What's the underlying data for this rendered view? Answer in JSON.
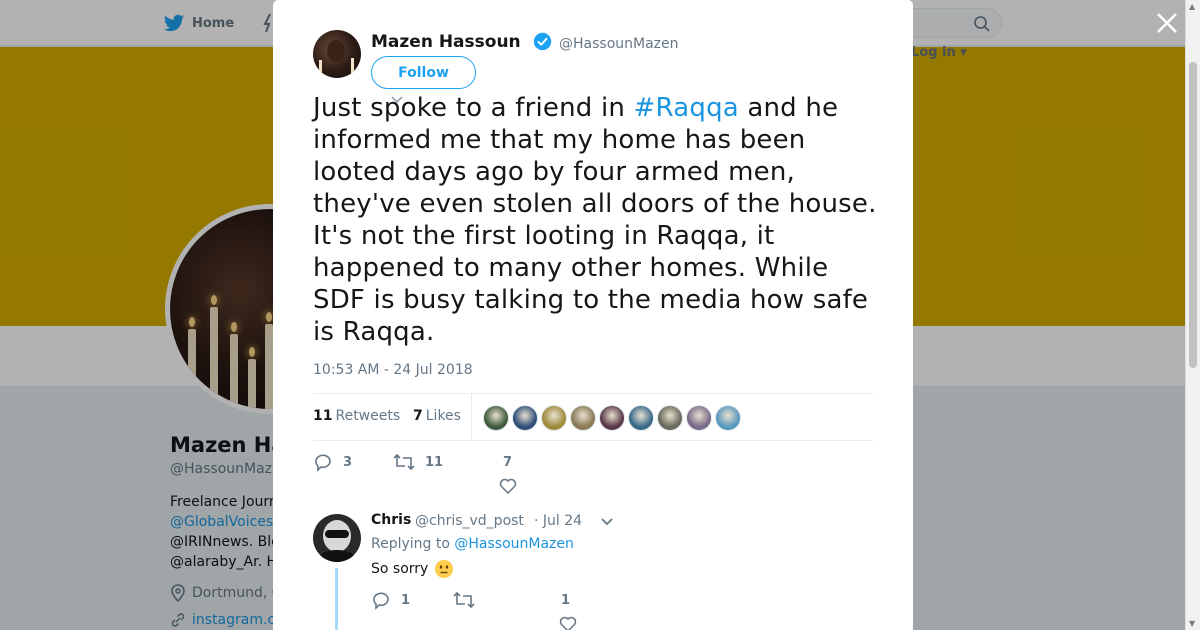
{
  "background": {
    "nav": {
      "home_label": "Home",
      "login_label": "Log in"
    },
    "profile": {
      "name_partial": "Mazen Ha",
      "handle_partial": "@HassounMaz",
      "bio_lines": [
        "Freelance Journ",
        "@GlobalVoices",
        "@IRINnews. Ble",
        "@alaraby_Ar. H"
      ],
      "location_partial": "Dortmund, G",
      "website_partial": "instagram.c"
    }
  },
  "tweet": {
    "author_name": "Mazen Hassoun",
    "author_handle": "@HassounMazen",
    "follow_label": "Follow",
    "text_before": "Just spoke to a friend in ",
    "hashtag": "#Raqqa",
    "text_after": " and he informed me that my home has been looted days ago by four armed men, they've even stolen all doors of the house. It's not the first looting in Raqqa, it happened to many other homes. While SDF is busy talking to the media how safe is Raqqa.",
    "timestamp": "10:53 AM - 24 Jul 2018",
    "retweets_count": "11",
    "retweets_label": "Retweets",
    "likes_count": "7",
    "likes_label": "Likes",
    "likers": [
      {
        "color": "#3d5a3b"
      },
      {
        "color": "#2f4f7a"
      },
      {
        "color": "#a08a3c"
      },
      {
        "color": "#8a7a55"
      },
      {
        "color": "#5a3a4a"
      },
      {
        "color": "#3a6a8a"
      },
      {
        "color": "#6a6a5a"
      },
      {
        "color": "#7a6a8a"
      },
      {
        "color": "#5a9ac0"
      }
    ],
    "actions": {
      "replies": "3",
      "retweets": "11",
      "likes": "7"
    }
  },
  "reply": {
    "author_name": "Chris",
    "author_handle": "@chris_vd_post",
    "date": "· Jul 24",
    "replying_prefix": "Replying to ",
    "replying_to": "@HassounMazen",
    "text": "So sorry",
    "actions": {
      "replies": "1",
      "retweets": "",
      "likes": "1"
    }
  },
  "colors": {
    "accent": "#1da1f2",
    "banner": "#d4ad00",
    "link": "#1b95e0"
  }
}
